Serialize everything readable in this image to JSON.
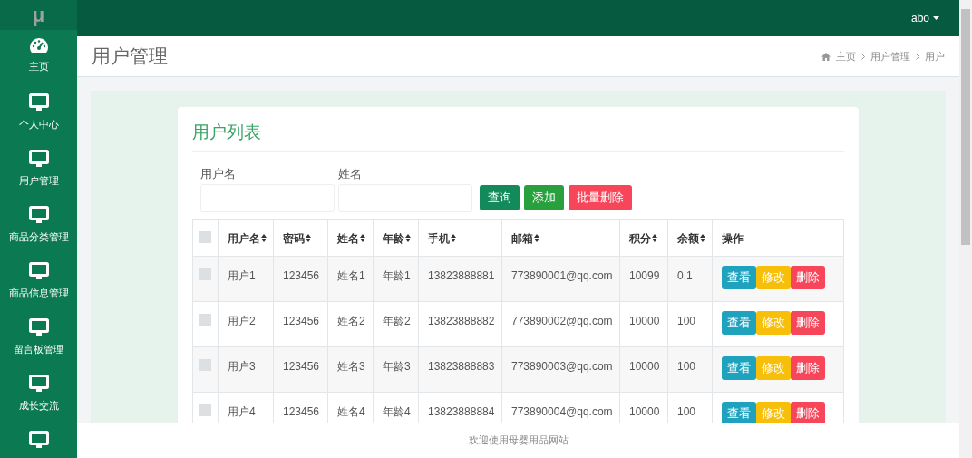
{
  "logo": "μ",
  "sidebar": {
    "items": [
      {
        "label": "主页",
        "kind": "dashboard"
      },
      {
        "label": "个人中心",
        "kind": "monitor"
      },
      {
        "label": "用户管理",
        "kind": "monitor"
      },
      {
        "label": "商品分类管理",
        "kind": "monitor"
      },
      {
        "label": "商品信息管理",
        "kind": "monitor"
      },
      {
        "label": "留言板管理",
        "kind": "monitor"
      },
      {
        "label": "成长交流",
        "kind": "monitor"
      },
      {
        "kind": "monitor"
      }
    ]
  },
  "topbar": {
    "user": "abo"
  },
  "page_title": "用户管理",
  "breadcrumb": [
    "主页",
    "用户管理",
    "用户"
  ],
  "card_title": "用户列表",
  "filters": [
    {
      "label": "用户名"
    },
    {
      "label": "姓名"
    }
  ],
  "buttons": [
    {
      "label": "查询",
      "kind": "query"
    },
    {
      "label": "添加",
      "kind": "add"
    },
    {
      "label": "批量删除",
      "kind": "delete"
    }
  ],
  "table": {
    "header_checked": false,
    "columns": [
      "用户名",
      "密码",
      "姓名",
      "年龄",
      "手机",
      "邮箱",
      "积分",
      "余额",
      "操作"
    ],
    "rows": [
      {
        "checked": false,
        "cells": [
          "用户1",
          "123456",
          "姓名1",
          "年龄1",
          "13823888881",
          "773890001@qq.com",
          "10099",
          "0.1"
        ],
        "actions": [
          "查看",
          "修改",
          "删除"
        ]
      },
      {
        "checked": false,
        "cells": [
          "用户2",
          "123456",
          "姓名2",
          "年龄2",
          "13823888882",
          "773890002@qq.com",
          "10000",
          "100"
        ],
        "actions": [
          "查看",
          "修改",
          "删除"
        ]
      },
      {
        "checked": false,
        "cells": [
          "用户3",
          "123456",
          "姓名3",
          "年龄3",
          "13823888883",
          "773890003@qq.com",
          "10000",
          "100"
        ],
        "actions": [
          "查看",
          "修改",
          "删除"
        ]
      },
      {
        "checked": false,
        "cells": [
          "用户4",
          "123456",
          "姓名4",
          "年龄4",
          "13823888884",
          "773890004@qq.com",
          "10000",
          "100"
        ],
        "actions": [
          "查看",
          "修改",
          "删除"
        ]
      }
    ]
  },
  "footer": "欢迎使用母婴用品网站"
}
